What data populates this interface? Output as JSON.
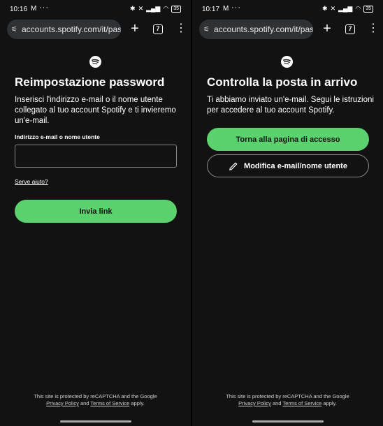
{
  "colors": {
    "background": "#121212",
    "accent": "#5bd26e",
    "field_border": "#878787"
  },
  "left": {
    "status": {
      "time": "10:16",
      "notif": "M",
      "dots": "···",
      "battery": "35"
    },
    "browser": {
      "url": "accounts.spotify.com/it/pass",
      "tab_count": "7",
      "plus": "+",
      "menu": "⋮"
    },
    "title": "Reimpostazione password",
    "description": "Inserisci l'indirizzo e-mail o il nome utente collegato al tuo account Spotify e ti invieremo un'e-mail.",
    "field_label": "Indirizzo e-mail o nome utente",
    "input_value": "",
    "help_link": "Serve aiuto?",
    "submit_label": "Invia link",
    "footer": {
      "text1": "This site is protected by reCAPTCHA and the Google",
      "privacy": "Privacy Policy",
      "and": " and ",
      "terms": "Terms of Service",
      "applies": " apply."
    }
  },
  "right": {
    "status": {
      "time": "10:17",
      "notif": "M",
      "dots": "···",
      "battery": "35"
    },
    "browser": {
      "url": "accounts.spotify.com/it/pass",
      "tab_count": "7",
      "plus": "+",
      "menu": "⋮"
    },
    "title": "Controlla la posta in arrivo",
    "description": "Ti abbiamo inviato un'e-mail. Segui le istruzioni per accedere al tuo account Spotify.",
    "primary_label": "Torna alla pagina di accesso",
    "secondary_label": "Modifica e-mail/nome utente",
    "footer": {
      "text1": "This site is protected by reCAPTCHA and the Google",
      "privacy": "Privacy Policy",
      "and": " and ",
      "terms": "Terms of Service",
      "applies": " apply."
    }
  }
}
